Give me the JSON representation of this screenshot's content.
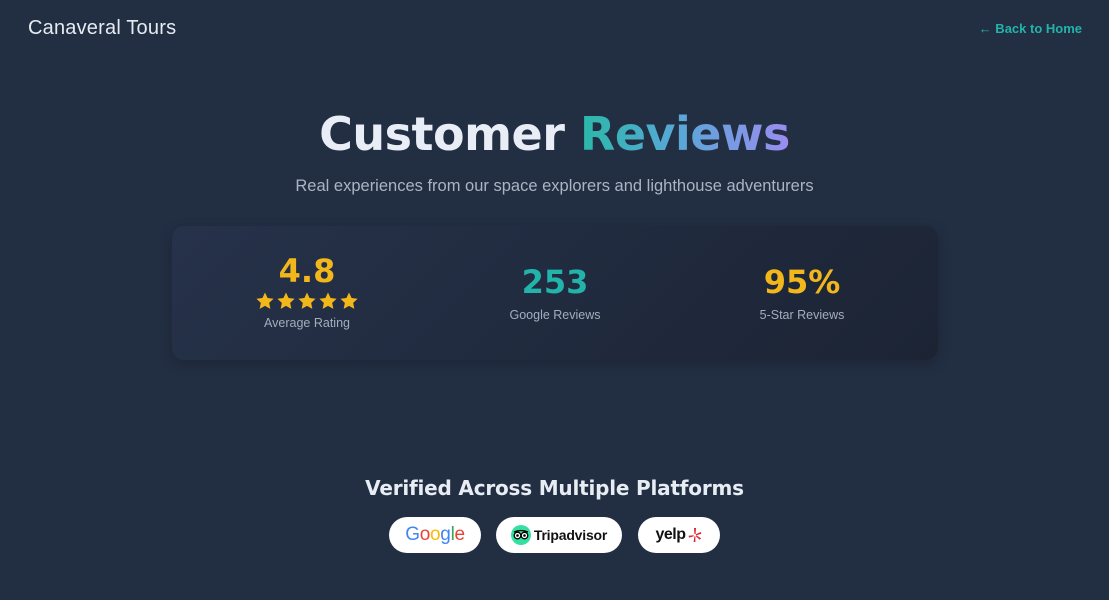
{
  "header": {
    "brand": "Canaveral Tours",
    "back_link": "← Back to Home"
  },
  "hero": {
    "title_part1": "Customer",
    "title_part2": "Reviews",
    "subtitle": "Real experiences from our space explorers and lighthouse adventurers"
  },
  "stats": {
    "rating": {
      "value": "4.8",
      "label": "Average Rating",
      "stars": 5
    },
    "google": {
      "value": "253",
      "label": "Google Reviews"
    },
    "five_star": {
      "value": "95%",
      "label": "5-Star Reviews"
    }
  },
  "platforms": {
    "title": "Verified Across Multiple Platforms",
    "google": {
      "name": "Google"
    },
    "tripadvisor": {
      "name": "Tripadvisor",
      "icon": "tripadvisor-owl-icon"
    },
    "yelp": {
      "name": "yelp",
      "icon": "yelp-burst-icon"
    }
  },
  "colors": {
    "background": "#222e42",
    "accent_teal": "#22b3aa",
    "accent_gold": "#f2b71a",
    "gradient_purple": "#9b8cf0"
  }
}
